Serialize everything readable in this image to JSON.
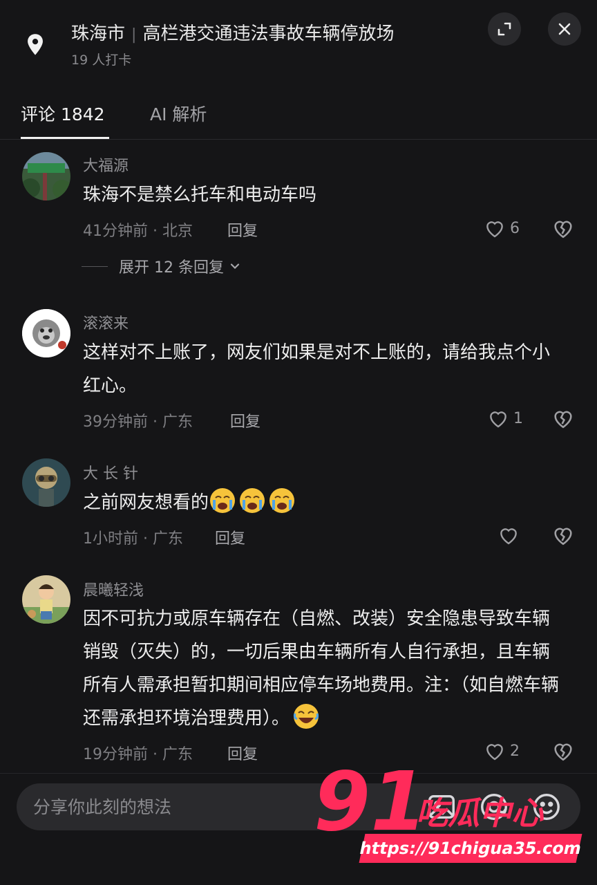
{
  "header": {
    "city": "珠海市",
    "place": "高栏港交通违法事故车辆停放场",
    "checkins": "19 人打卡"
  },
  "tabs": {
    "comments": "评论 1842",
    "ai": "AI 解析"
  },
  "comments": [
    {
      "user": "大福源",
      "text": "珠海不是禁么托车和电动车吗",
      "meta": "41分钟前 · 北京",
      "reply": "回复",
      "likes": "6",
      "expand": "展开 12 条回复"
    },
    {
      "user": "滚滚来",
      "text": "这样对不上账了，网友们如果是对不上账的，请给我点个小红心。",
      "meta": "39分钟前 · 广东",
      "reply": "回复",
      "likes": "1"
    },
    {
      "user": "大 长 针",
      "text": "之前网友想看的",
      "meta": "1小时前 · 广东",
      "reply": "回复",
      "likes": ""
    },
    {
      "user": "晨曦轻浅",
      "text": "因不可抗力或原车辆存在（自燃、改装）安全隐患导致车辆销毁（灭失）的，一切后果由车辆所有人自行承担，且车辆所有人需承担暂扣期间相应停车场地费用。注：（如自燃车辆还需承担环境治理费用）。",
      "meta": "19分钟前 · 广东",
      "reply": "回复",
      "likes": "2"
    }
  ],
  "input": {
    "placeholder": "分享你此刻的想法"
  },
  "watermark": {
    "number": "91",
    "name": "吃瓜中心",
    "url": "https://91chigua35.com"
  },
  "colors": {
    "background": "#151517",
    "watermark": "#ff2b5a",
    "emoji": "#f6c33b"
  }
}
